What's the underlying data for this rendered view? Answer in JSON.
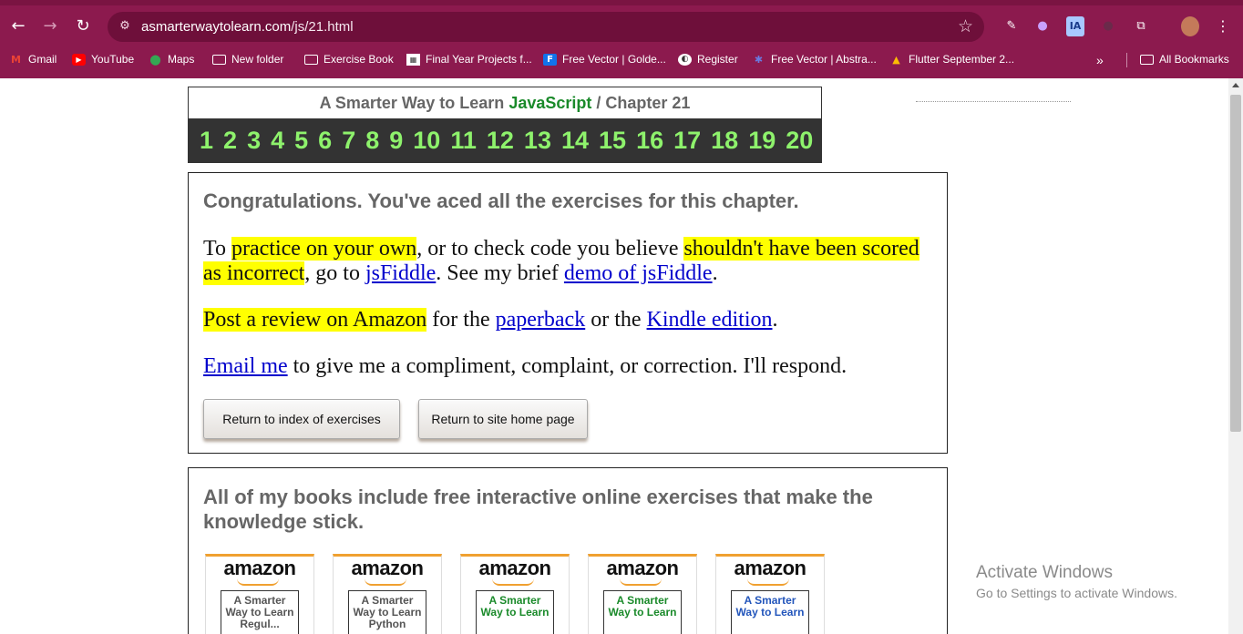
{
  "browser": {
    "url_domain": "asmarterwaytolearn.com",
    "url_path": "/js/21.html",
    "ext_ia": "IA",
    "bookmarks": [
      "Gmail",
      "YouTube",
      "Maps",
      "New folder",
      "Exercise Book",
      "Final Year Projects f...",
      "Free Vector | Golde...",
      "Register",
      "Free Vector | Abstra...",
      "Flutter September 2..."
    ],
    "all_bookmarks": "All Bookmarks",
    "overflow": "»"
  },
  "header": {
    "title_prefix": "A Smarter Way to Learn",
    "title_js": "JavaScript",
    "title_suffix": " /  Chapter 21",
    "chapters": [
      "1",
      "2",
      "3",
      "4",
      "5",
      "6",
      "7",
      "8",
      "9",
      "10",
      "11",
      "12",
      "13",
      "14",
      "15",
      "16",
      "17",
      "18",
      "19",
      "20"
    ]
  },
  "main": {
    "congrats": "Congratulations. You've aced all the exercises for this chapter.",
    "p1_a": "To ",
    "p1_hl1": "practice on your own",
    "p1_b": ", or to check code you believe ",
    "p1_hl2": "shouldn't have been scored as incorrect",
    "p1_c": ", go to ",
    "p1_link1": "jsFiddle",
    "p1_d": ". See my brief ",
    "p1_link2": "demo of jsFiddle",
    "p1_e": ".",
    "p2_hl": "Post a review on Amazon",
    "p2_a": " for the ",
    "p2_link1": "paperback",
    "p2_b": " or the ",
    "p2_link2": "Kindle edition",
    "p2_c": ".",
    "p3_link": "Email me",
    "p3_a": " to give me a compliment, complaint, or correction. I'll respond.",
    "btn_index": "Return to index of exercises",
    "btn_home": "Return to site home page"
  },
  "books": {
    "heading": " All of my books include free interactive online exercises that make the knowledge stick.",
    "logo": "amazon",
    "items": [
      {
        "cover": "A Smarter Way to Learn Regul...",
        "color": "#555555"
      },
      {
        "cover": "A Smarter Way to Learn Python",
        "color": "#555555"
      },
      {
        "cover": "A Smarter Way to Learn",
        "color": "#1a8a2a"
      },
      {
        "cover": "A Smarter Way to Learn",
        "color": "#1a8a2a"
      },
      {
        "cover": "A Smarter Way to Learn",
        "color": "#2255bb"
      }
    ]
  },
  "watermark": {
    "line1": "Activate Windows",
    "line2": "Go to Settings to activate Windows."
  }
}
